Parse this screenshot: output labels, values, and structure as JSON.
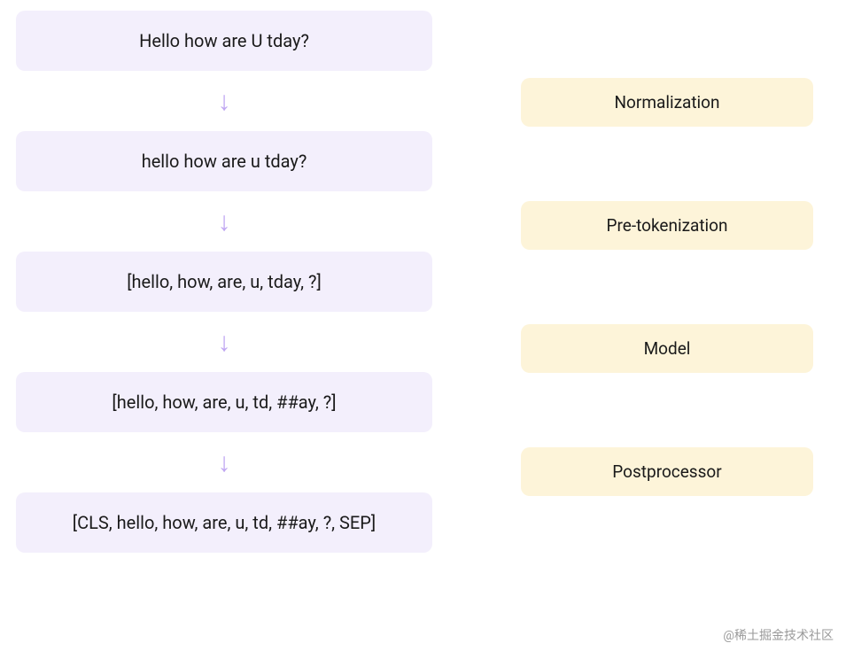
{
  "steps": [
    "Hello how are U tday?",
    "hello how are u tday?",
    "[hello, how, are, u, tday, ?]",
    "[hello, how, are, u, td, ##ay, ?]",
    "[CLS, hello, how, are, u, td, ##ay, ?, SEP]"
  ],
  "stages": [
    "Normalization",
    "Pre-tokenization",
    "Model",
    "Postprocessor"
  ],
  "arrow_glyph": "↓",
  "watermark": "@稀土掘金技术社区"
}
